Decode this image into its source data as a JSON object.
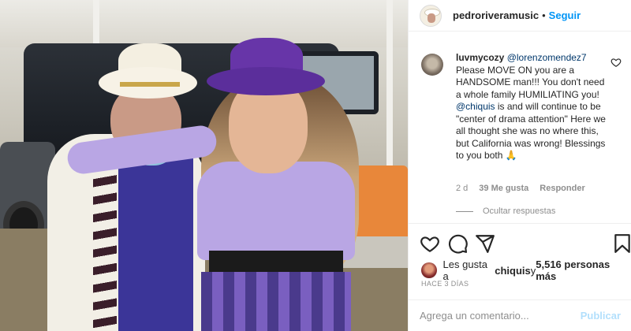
{
  "header": {
    "username": "pedroriveramusic",
    "dot": "•",
    "follow_label": "Seguir"
  },
  "comment": {
    "username": "luvmycozy",
    "mention": "@lorenzomendez7",
    "text_1": " Please MOVE ON you are a HANDSOME man!!! You don't need a whole family HUMILIATING you! ",
    "mention_2": "@chiquis",
    "text_2": " is and will continue to be \"center of drama attention\" Here we all thought she was no where this, but California was wrong! Blessings to you both 🙏",
    "age": "2 d",
    "likes": "39 Me gusta",
    "reply_label": "Responder"
  },
  "replies": {
    "hide_label": "Ocultar respuestas"
  },
  "likes": {
    "prefix": "Les gusta a ",
    "user": "chiquis",
    "middle": " y ",
    "count": "5,516 personas más"
  },
  "timestamp": "HACE 3 DÍAS",
  "add_comment": {
    "placeholder": "Agrega un comentario...",
    "post_label": "Publicar"
  },
  "colors": {
    "accent": "#0095f6",
    "post_disabled": "#b2dffc",
    "muted": "#8e8e8e",
    "mention": "#00376b"
  },
  "icons": [
    "heart-icon",
    "comment-icon",
    "share-icon",
    "bookmark-icon",
    "small-heart-icon"
  ]
}
